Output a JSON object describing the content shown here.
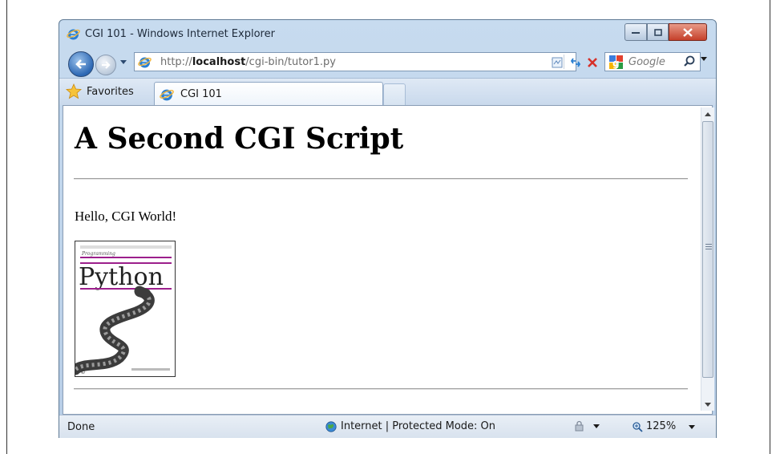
{
  "window": {
    "title": "CGI 101 - Windows Internet Explorer"
  },
  "address": {
    "url_prefix": "http://",
    "url_host": "localhost",
    "url_path": "/cgi-bin/tutor1.py"
  },
  "search": {
    "placeholder": "Google"
  },
  "tabs": {
    "favorites_label": "Favorites",
    "active_tab_label": "CGI 101"
  },
  "page": {
    "heading": "A Second CGI Script",
    "greeting": "Hello, CGI World!",
    "book_title": "Python",
    "book_subtitle": "Programming"
  },
  "status": {
    "state": "Done",
    "zone": "Internet | Protected Mode: On",
    "zoom": "125%"
  },
  "colors": {
    "chrome": "#c7dbef",
    "close_button": "#c5402a",
    "book_accent": "#9c1f8c"
  },
  "icons": [
    "ie-icon",
    "back-icon",
    "forward-icon",
    "refresh-icon",
    "stop-icon",
    "star-icon",
    "search-icon",
    "globe-icon"
  ]
}
